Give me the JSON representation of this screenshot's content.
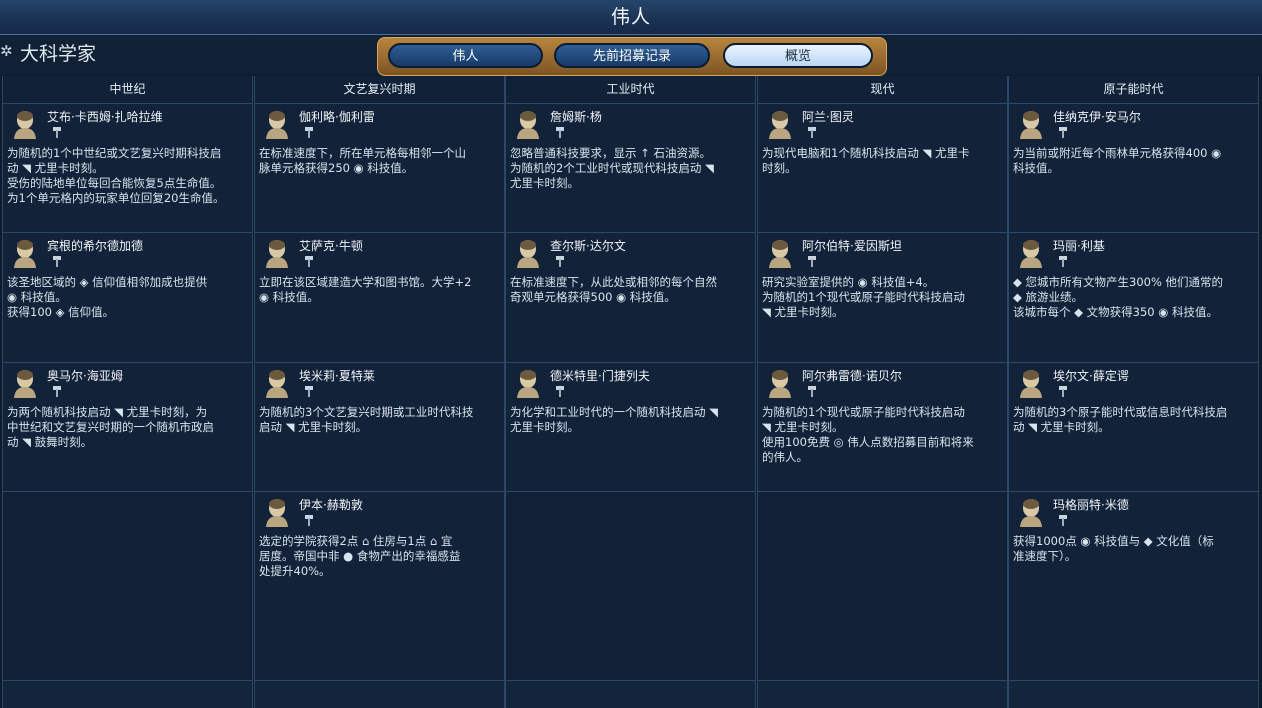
{
  "header": {
    "title": "伟人"
  },
  "subheader": {
    "title": "大科学家"
  },
  "tabs": [
    {
      "label": "伟人",
      "active": false
    },
    {
      "label": "先前招募记录",
      "active": false
    },
    {
      "label": "概览",
      "active": true
    }
  ],
  "eras": [
    {
      "name": "中世纪",
      "cells": [
        {
          "name": "艾布·卡西姆·扎哈拉维",
          "lines": [
            "为随机的1个中世纪或文艺复兴时期科技启",
            "动 ◥ 尤里卡时刻。",
            "受伤的陆地单位每回合能恢复5点生命值。",
            "为1个单元格内的玩家单位回复20生命值。"
          ]
        },
        {
          "name": "宾根的希尔德加德",
          "lines": [
            "该圣地区域的 ◈ 信仰值相邻加成也提供",
            "◉ 科技值。",
            "获得100 ◈ 信仰值。"
          ]
        },
        {
          "name": "奥马尔·海亚姆",
          "lines": [
            "为两个随机科技启动 ◥ 尤里卡时刻，为",
            "中世纪和文艺复兴时期的一个随机市政启",
            "动 ◥ 鼓舞时刻。"
          ]
        },
        null
      ]
    },
    {
      "name": "文艺复兴时期",
      "cells": [
        {
          "name": "伽利略·伽利雷",
          "lines": [
            "在标准速度下，所在单元格每相邻一个山",
            "脉单元格获得250 ◉ 科技值。"
          ]
        },
        {
          "name": "艾萨克·牛顿",
          "lines": [
            "立即在该区域建造大学和图书馆。大学+2",
            "◉ 科技值。"
          ]
        },
        {
          "name": "埃米莉·夏特莱",
          "lines": [
            "为随机的3个文艺复兴时期或工业时代科技",
            "启动 ◥ 尤里卡时刻。"
          ]
        },
        {
          "name": "伊本·赫勒敦",
          "lines": [
            "选定的学院获得2点 ⌂ 住房与1点 ⌂ 宜",
            "居度。帝国中非 ● 食物产出的幸福感益",
            "处提升40%。"
          ]
        }
      ]
    },
    {
      "name": "工业时代",
      "cells": [
        {
          "name": "詹姆斯·杨",
          "lines": [
            "忽略普通科技要求，显示 ↑ 石油资源。",
            "为随机的2个工业时代或现代科技启动 ◥",
            "尤里卡时刻。"
          ]
        },
        {
          "name": "查尔斯·达尔文",
          "lines": [
            "在标准速度下，从此处或相邻的每个自然",
            "奇观单元格获得500 ◉ 科技值。"
          ]
        },
        {
          "name": "德米特里·门捷列夫",
          "lines": [
            "为化学和工业时代的一个随机科技启动 ◥",
            "尤里卡时刻。"
          ]
        },
        null
      ]
    },
    {
      "name": "现代",
      "cells": [
        {
          "name": "阿兰·图灵",
          "lines": [
            "为现代电脑和1个随机科技启动 ◥ 尤里卡",
            "时刻。"
          ]
        },
        {
          "name": "阿尔伯特·爱因斯坦",
          "lines": [
            "研究实验室提供的 ◉ 科技值+4。",
            "为随机的1个现代或原子能时代科技启动",
            "◥ 尤里卡时刻。"
          ]
        },
        {
          "name": "阿尔弗雷德·诺贝尔",
          "lines": [
            "为随机的1个现代或原子能时代科技启动",
            "◥ 尤里卡时刻。",
            "使用100免费 ◎ 伟人点数招募目前和将来",
            "的伟人。"
          ]
        },
        null
      ]
    },
    {
      "name": "原子能时代",
      "cells": [
        {
          "name": "佳纳克伊·安马尔",
          "lines": [
            "为当前或附近每个雨林单元格获得400 ◉",
            "科技值。"
          ]
        },
        {
          "name": "玛丽·利基",
          "lines": [
            "◆ 您城市所有文物产生300% 他们通常的",
            "◆ 旅游业绩。",
            "该城市每个 ◆ 文物获得350 ◉ 科技值。"
          ]
        },
        {
          "name": "埃尔文·薛定谔",
          "lines": [
            "为随机的3个原子能时代或信息时代科技启",
            "动 ◥ 尤里卡时刻。"
          ]
        },
        {
          "name": "玛格丽特·米德",
          "lines": [
            "获得1000点 ◉ 科技值与 ◆ 文化值（标",
            "准速度下）。"
          ]
        }
      ]
    }
  ]
}
